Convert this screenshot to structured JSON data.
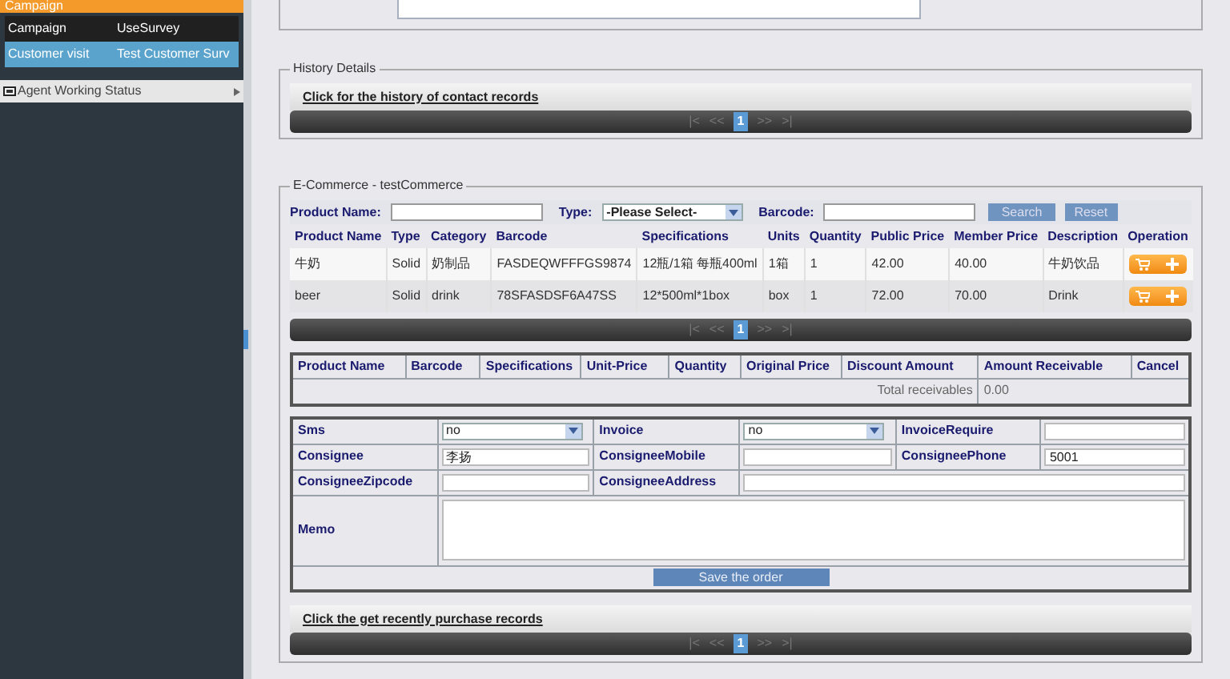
{
  "sidebar": {
    "top_menu": {
      "label": "Campaign"
    },
    "submenu_rows": [
      {
        "cells": [
          "Campaign",
          "UseSurvey"
        ],
        "selected": false
      },
      {
        "cells": [
          "Customer visit",
          "Test Customer Surv"
        ],
        "selected": true
      }
    ],
    "agent_status": {
      "label": "Agent Working Status"
    }
  },
  "history": {
    "legend": "History Details",
    "link": "Click for the history of contact records",
    "pager": {
      "first": "|<",
      "prev": "<<",
      "page": "1",
      "next": ">>",
      "last": ">|"
    }
  },
  "ecommerce": {
    "legend": "E-Commerce - testCommerce",
    "search": {
      "product_name_label": "Product Name:",
      "type_label": "Type:",
      "type_value": "-Please Select-",
      "barcode_label": "Barcode:",
      "search_button": "Search",
      "reset_button": "Reset"
    },
    "products": {
      "columns": [
        "Product Name",
        "Type",
        "Category",
        "Barcode",
        "Specifications",
        "Units",
        "Quantity",
        "Public Price",
        "Member Price",
        "Description",
        "Operation"
      ],
      "rows": [
        {
          "cells": [
            "牛奶",
            "Solid",
            "奶制品",
            "FASDEQWFFFGS9874",
            "12瓶/1箱 每瓶400ml",
            "1箱",
            "1",
            "42.00",
            "40.00",
            "牛奶饮品"
          ]
        },
        {
          "cells": [
            "beer",
            "Solid",
            "drink",
            "78SFASDSF6A47SS",
            "12*500ml*1box",
            "box",
            "1",
            "72.00",
            "70.00",
            "Drink"
          ]
        }
      ]
    },
    "products_pager": {
      "first": "|<",
      "prev": "<<",
      "page": "1",
      "next": ">>",
      "last": ">|"
    },
    "order_table": {
      "columns": [
        "Product Name",
        "Barcode",
        "Specifications",
        "Unit-Price",
        "Quantity",
        "Original Price",
        "Discount Amount",
        "Amount Receivable",
        "Cancel"
      ],
      "total_label": "Total receivables",
      "total_value": "0.00"
    },
    "form": {
      "rows": [
        [
          {
            "label": "Sms",
            "kind": "select",
            "value": "no"
          },
          {
            "label": "Invoice",
            "kind": "select",
            "value": "no"
          },
          {
            "label": "InvoiceRequire",
            "kind": "input"
          }
        ],
        [
          {
            "label": "Consignee",
            "kind": "input",
            "value": "李扬"
          },
          {
            "label": "ConsigneeMobile",
            "kind": "input"
          },
          {
            "label": "ConsigneePhone",
            "kind": "input",
            "value": "5001"
          }
        ],
        [
          {
            "label": "ConsigneeZipcode",
            "kind": "input"
          },
          {
            "label": "ConsigneeAddress",
            "kind": "wide"
          }
        ]
      ],
      "memo_label": "Memo",
      "save_button": "Save the order"
    },
    "recent_link": "Click the get recently purchase records",
    "recent_pager": {
      "first": "|<",
      "prev": "<<",
      "page": "1",
      "next": ">>",
      "last": ">|"
    }
  }
}
